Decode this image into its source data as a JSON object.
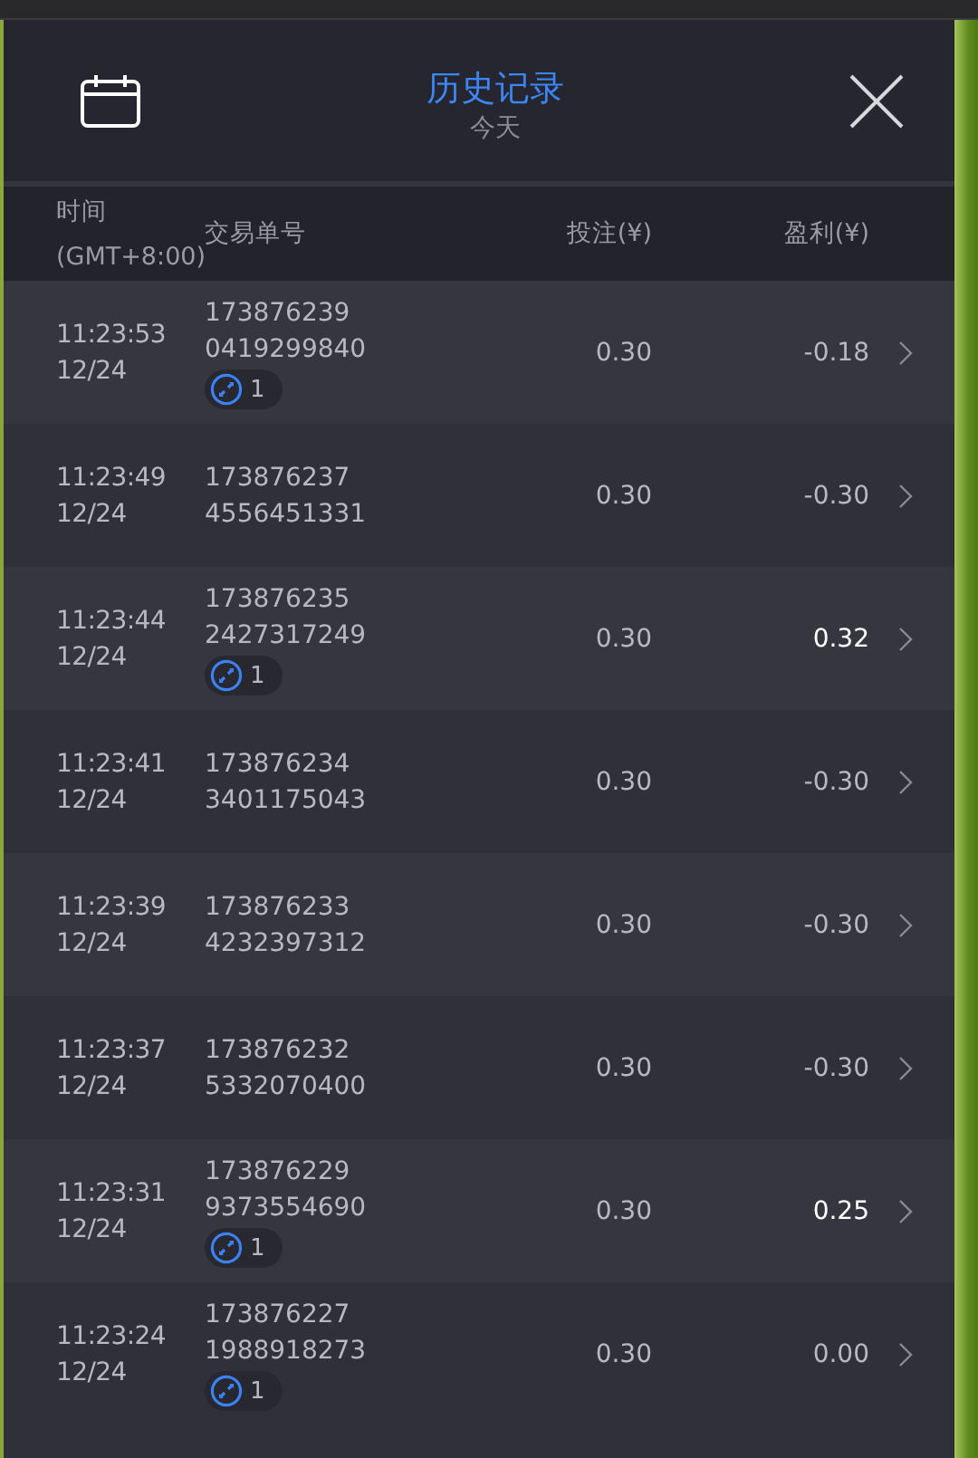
{
  "header": {
    "title": "历史记录",
    "subtitle": "今天"
  },
  "columns": {
    "time": [
      "时间",
      "(GMT+8:00)"
    ],
    "order": "交易单号",
    "stake": "投注(¥)",
    "profit": "盈利(¥)"
  },
  "rows": [
    {
      "time": "11:23:53",
      "date": "12/24",
      "order_id": [
        "173876239",
        "0419299840"
      ],
      "badge": "1",
      "stake": "0.30",
      "profit": "-0.18",
      "win": false
    },
    {
      "time": "11:23:49",
      "date": "12/24",
      "order_id": [
        "173876237",
        "4556451331"
      ],
      "stake": "0.30",
      "profit": "-0.30",
      "win": false
    },
    {
      "time": "11:23:44",
      "date": "12/24",
      "order_id": [
        "173876235",
        "2427317249"
      ],
      "badge": "1",
      "stake": "0.30",
      "profit": "0.32",
      "win": true
    },
    {
      "time": "11:23:41",
      "date": "12/24",
      "order_id": [
        "173876234",
        "3401175043"
      ],
      "stake": "0.30",
      "profit": "-0.30",
      "win": false
    },
    {
      "time": "11:23:39",
      "date": "12/24",
      "order_id": [
        "173876233",
        "4232397312"
      ],
      "stake": "0.30",
      "profit": "-0.30",
      "win": false
    },
    {
      "time": "11:23:37",
      "date": "12/24",
      "order_id": [
        "173876232",
        "5332070400"
      ],
      "stake": "0.30",
      "profit": "-0.30",
      "win": false
    },
    {
      "time": "11:23:31",
      "date": "12/24",
      "order_id": [
        "173876229",
        "9373554690"
      ],
      "badge": "1",
      "stake": "0.30",
      "profit": "0.25",
      "win": true
    },
    {
      "time": "11:23:24",
      "date": "12/24",
      "order_id": [
        "173876227",
        "1988918273"
      ],
      "badge": "1",
      "stake": "0.30",
      "profit": "0.00",
      "win": false
    }
  ]
}
